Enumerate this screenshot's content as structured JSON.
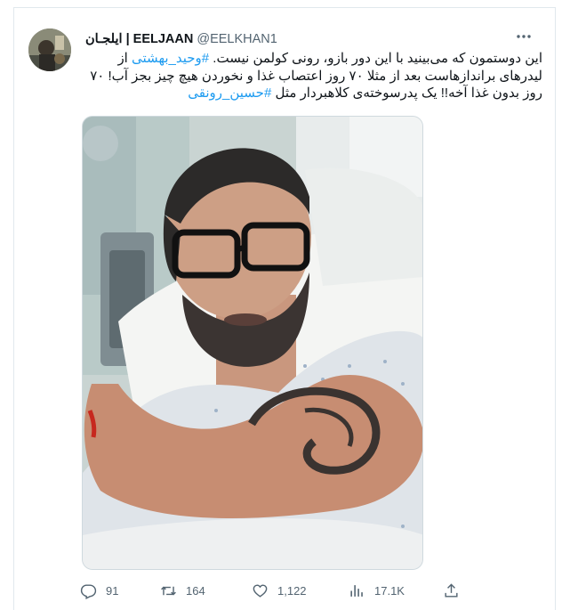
{
  "tweet": {
    "display_name": "ایلجـان | EELJAAN",
    "handle": "@EELKHAN1",
    "text": {
      "part1": "این دوستمون که می‌بینید با این دور بازو، رونی کولمن نیست. ",
      "hashtag1": "#وحید_بهشتی",
      "part2": " از لیدرهای براندازهاست بعد از مثلا ۷۰ روز اعتصاب غذا و نخوردن هیچ چیز بجز آب! ۷۰ روز بدون غذا آخه!! یک پدرسوخته‌ی کلاهبردار مثل ",
      "hashtag2": "#حسین_رونقی"
    }
  },
  "actions": {
    "replies": "91",
    "retweets": "164",
    "likes": "1,122",
    "views": "17.1K"
  },
  "colors": {
    "accent": "#1d9bf0",
    "secondary_text": "#536471",
    "border": "#e1e8ed"
  },
  "icons": [
    "more-icon",
    "reply-icon",
    "retweet-icon",
    "like-icon",
    "views-icon",
    "share-icon"
  ]
}
